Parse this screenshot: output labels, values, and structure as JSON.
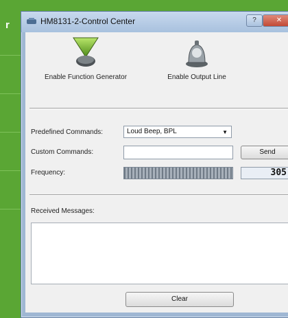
{
  "background": {
    "partial_label": "r"
  },
  "window": {
    "title": "HM8131-2-Control Center"
  },
  "toolbar": {
    "enable_function_generator": "Enable Function Generator",
    "enable_output_line": "Enable Output Line"
  },
  "controls": {
    "predefined_label": "Predefined Commands:",
    "predefined_value": "Loud Beep, BPL",
    "custom_label": "Custom Commands:",
    "custom_value": "",
    "send_label": "Send",
    "frequency_label": "Frequency:",
    "frequency_value": "305"
  },
  "messages": {
    "label": "Received Messages:",
    "clear_label": "Clear"
  },
  "colors": {
    "background_green": "#5aa634",
    "window_frame": "#9fb7d3"
  },
  "icons": [
    "funnel-icon",
    "bell-icon",
    "chevron-down-icon",
    "app-icon"
  ]
}
